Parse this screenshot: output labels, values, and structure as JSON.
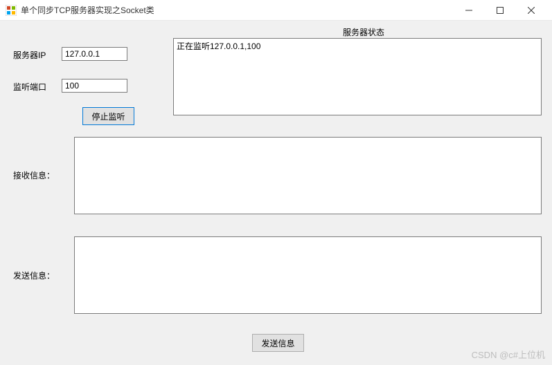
{
  "titlebar": {
    "title": "单个同步TCP服务器实现之Socket类"
  },
  "labels": {
    "server_ip": "服务器IP",
    "listen_port": "监听端口",
    "server_status": "服务器状态",
    "receive_info": "接收信息：",
    "send_info": "发送信息："
  },
  "inputs": {
    "server_ip_value": "127.0.0.1",
    "listen_port_value": "100",
    "status_text": "正在监听127.0.0.1,100",
    "receive_text": "",
    "send_text": ""
  },
  "buttons": {
    "stop_listen": "停止监听",
    "send_info": "发送信息"
  },
  "watermark": "CSDN @c#上位机"
}
